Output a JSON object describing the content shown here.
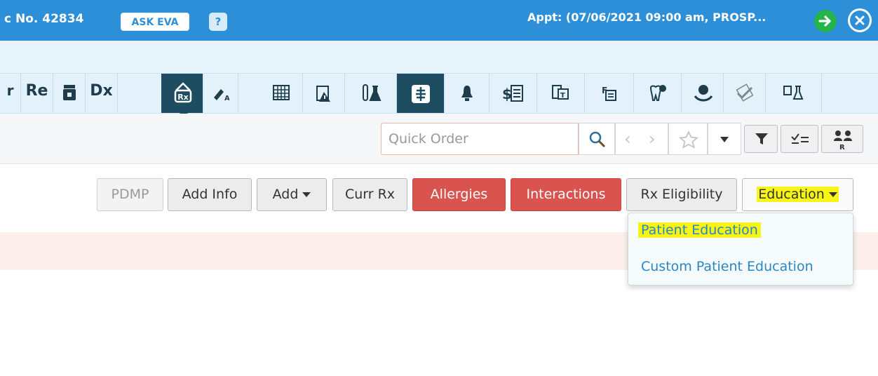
{
  "header": {
    "chart_no": "c No. 42834",
    "ask_eva": "ASK EVA",
    "help": "?",
    "appointment": "Appt: (07/06/2021 09:00 am, PROSP..."
  },
  "toolbar": {
    "items": [
      {
        "label": "",
        "icon": "prescription-fragment-icon"
      },
      {
        "label": "Re",
        "icon": "re-icon"
      },
      {
        "label": "",
        "icon": "pill-bottle-icon"
      },
      {
        "label": "Dx",
        "icon": "dx-icon"
      },
      {
        "label": "",
        "icon": "rx-icon",
        "active": true
      },
      {
        "label": "",
        "icon": "allergy-icon"
      },
      {
        "label": "",
        "icon": "grid-icon"
      },
      {
        "label": "",
        "icon": "clipboard-alert-icon"
      },
      {
        "label": "",
        "icon": "lab-icon"
      },
      {
        "label": "",
        "icon": "imaging-icon",
        "active": true
      },
      {
        "label": "",
        "icon": "bell-icon"
      },
      {
        "label": "",
        "icon": "billing-icon"
      },
      {
        "label": "",
        "icon": "translate-icon"
      },
      {
        "label": "",
        "icon": "flowsheet-icon"
      },
      {
        "label": "",
        "icon": "dental-icon"
      },
      {
        "label": "",
        "icon": "stethoscope-icon"
      },
      {
        "label": "",
        "icon": "checklist-icon"
      },
      {
        "label": "",
        "icon": "lab-results-icon"
      }
    ]
  },
  "quick_order": {
    "placeholder": "Quick Order"
  },
  "actions": {
    "pdmp": "PDMP",
    "add_info": "Add Info",
    "add": "Add",
    "curr_rx": "Curr Rx",
    "allergies": "Allergies",
    "interactions": "Interactions",
    "rx_eligibility": "Rx Eligibility",
    "education": "Education"
  },
  "education_menu": {
    "items": [
      "Patient Education",
      "Custom Patient Education"
    ]
  },
  "colors": {
    "header_blue": "#2d8fd8",
    "danger_red": "#d9534f",
    "highlight_yellow": "#f6f515",
    "active_tool": "#1e4d62"
  }
}
